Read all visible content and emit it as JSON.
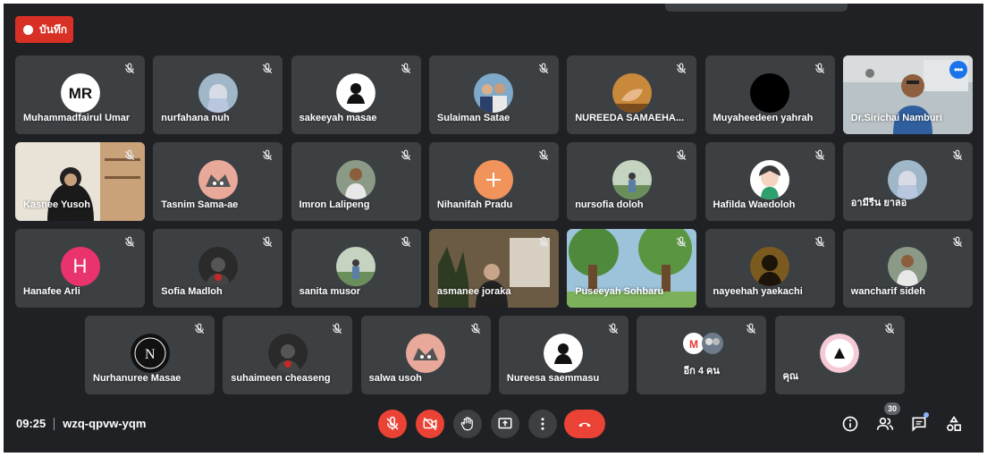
{
  "meeting": {
    "recording_label": "บันทึก",
    "time": "09:25",
    "code": "wzq-qpvw-yqm",
    "people_count": "30"
  },
  "rows": [
    [
      {
        "name": "Muhammadfairul Umar",
        "avatar": "mr-logo-avatar"
      },
      {
        "name": "nurfahana nuh",
        "avatar": "hijab-photo-avatar"
      },
      {
        "name": "sakeeyah masae",
        "avatar": "silhouette-logo-avatar"
      },
      {
        "name": "Sulaiman Satae",
        "avatar": "group-photo-avatar"
      },
      {
        "name": "NUREEDA SAMAEHA...",
        "avatar": "hand-photo-avatar"
      },
      {
        "name": "Muyaheedeen yahrah",
        "avatar": "black-avatar"
      },
      {
        "name": "Dr.Sirichai Namburi",
        "avatar": "video-feed",
        "video": true,
        "active": true
      }
    ],
    [
      {
        "name": "Kasnee Yusoh",
        "avatar": "video-feed",
        "video": true
      },
      {
        "name": "Tasnim Sama-ae",
        "avatar": "anime-avatar"
      },
      {
        "name": "Imron Lalipeng",
        "avatar": "person-photo-avatar"
      },
      {
        "name": "Nihanifah Pradu",
        "avatar": "orange-logo-avatar"
      },
      {
        "name": "nursofia doloh",
        "avatar": "outdoor-photo-avatar"
      },
      {
        "name": "Hafilda Waedoloh",
        "avatar": "cartoon-avatar"
      },
      {
        "name": "อามีรีน ยาลอ",
        "avatar": "hijab-photo-avatar"
      }
    ],
    [
      {
        "name": "Hanafee Arli",
        "avatar": "letter-avatar",
        "letter": "H",
        "color": "#e8336d"
      },
      {
        "name": "Sofia Madloh",
        "avatar": "dark-photo-avatar"
      },
      {
        "name": "sanita musor",
        "avatar": "outdoor-photo-avatar"
      },
      {
        "name": "asmanee joraka",
        "avatar": "video-feed",
        "video": true
      },
      {
        "name": "Puseeyah Sohbaru",
        "avatar": "video-feed",
        "video": true
      },
      {
        "name": "nayeehah yaekachi",
        "avatar": "sunset-avatar"
      },
      {
        "name": "wancharif sideh",
        "avatar": "person-photo-avatar"
      }
    ],
    [
      {
        "name": "Nurhanuree Masae",
        "avatar": "nureen-logo-avatar"
      },
      {
        "name": "suhaimeen cheaseng",
        "avatar": "dark-photo-avatar"
      },
      {
        "name": "salwa usoh",
        "avatar": "anime-avatar"
      },
      {
        "name": "Nureesa saemmasu",
        "avatar": "silhouette-logo-avatar"
      },
      {
        "name": "อีก 4 คน",
        "avatar": "group-avatars",
        "others": true
      },
      {
        "name": "คุณ",
        "avatar": "pink-logo-avatar"
      }
    ]
  ],
  "colors": {
    "background": "#202124",
    "tile": "#3c4043",
    "record": "#d93025",
    "hangup": "#ea4335",
    "active_outline": "#8ab4f8"
  }
}
